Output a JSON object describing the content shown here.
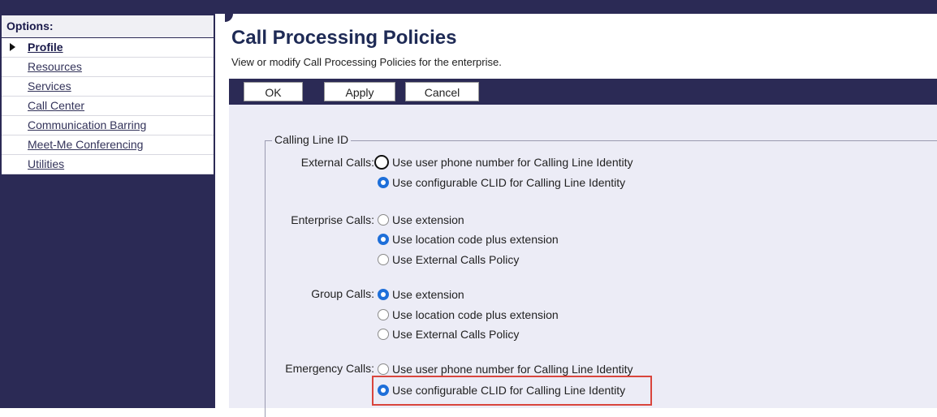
{
  "sidebar": {
    "title": "Options:",
    "items": [
      {
        "label": "Profile"
      },
      {
        "label": "Resources"
      },
      {
        "label": "Services"
      },
      {
        "label": "Call Center"
      },
      {
        "label": "Communication Barring"
      },
      {
        "label": "Meet-Me Conferencing"
      },
      {
        "label": "Utilities"
      }
    ]
  },
  "header": {
    "title": "Call Processing Policies",
    "description": "View or modify Call Processing Policies for the enterprise."
  },
  "toolbar": {
    "ok_label": "OK",
    "apply_label": "Apply",
    "cancel_label": "Cancel"
  },
  "clid": {
    "legend": "Calling Line ID",
    "external": {
      "label": "External Calls:",
      "options": [
        "Use user phone number for Calling Line Identity",
        "Use configurable CLID for Calling Line Identity"
      ],
      "selected": 1
    },
    "enterprise": {
      "label": "Enterprise Calls:",
      "options": [
        "Use extension",
        "Use location code plus extension",
        "Use External Calls Policy"
      ],
      "selected": 1
    },
    "group": {
      "label": "Group Calls:",
      "options": [
        "Use extension",
        "Use location code plus extension",
        "Use External Calls Policy"
      ],
      "selected": 0
    },
    "emergency": {
      "label": "Emergency Calls:",
      "options": [
        "Use user phone number for Calling Line Identity",
        "Use configurable CLID for Calling Line Identity"
      ],
      "selected": 1
    }
  },
  "colors": {
    "nav_bg": "#2b2a55",
    "content_bg": "#ececf6",
    "radio_selected": "#1e6fd9",
    "highlight": "#d9453c"
  }
}
